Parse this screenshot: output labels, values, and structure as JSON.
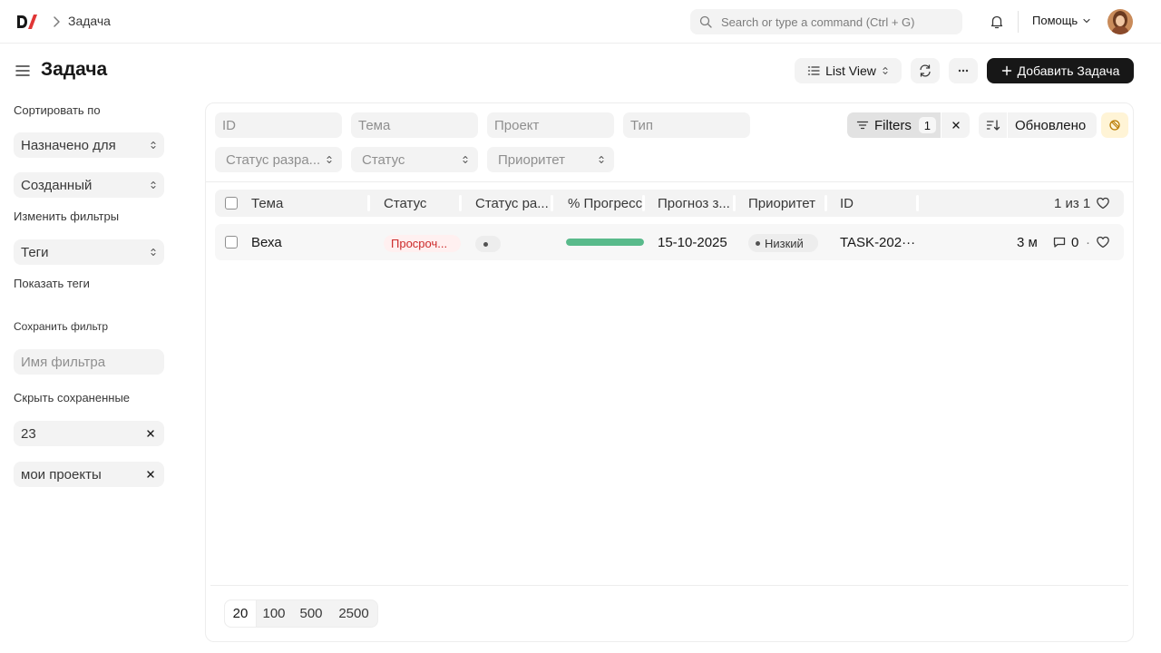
{
  "navbar": {
    "breadcrumb": "Задача",
    "search_placeholder": "Search or type a command (Ctrl + G)",
    "help_label": "Помощь"
  },
  "header": {
    "title": "Задача",
    "view_label": "List View",
    "add_label": "Добавить Задача"
  },
  "sidebar": {
    "sort_label": "Сортировать по",
    "assigned_label": "Назначено для",
    "created_label": "Созданный",
    "edit_filters_label": "Изменить фильтры",
    "tags_label": "Теги",
    "show_tags_label": "Показать теги",
    "save_filter_label": "Сохранить фильтр",
    "filter_name_placeholder": "Имя фильтра",
    "hide_saved_label": "Скрыть сохраненные",
    "saved_filters": [
      "23",
      "мои проекты"
    ]
  },
  "filters": {
    "id_placeholder": "ID",
    "subject_placeholder": "Тема",
    "project_placeholder": "Проект",
    "type_placeholder": "Тип",
    "dev_status_placeholder": "Статус разра...",
    "status_placeholder": "Статус",
    "priority_placeholder": "Приоритет",
    "filters_label": "Filters",
    "filters_count": "1",
    "sort_label": "Обновлено"
  },
  "table": {
    "columns": [
      "Тема",
      "Статус",
      "Статус ра...",
      "% Прогресс",
      "Прогноз з...",
      "Приоритет",
      "ID"
    ],
    "count_label": "1 из 1",
    "rows": [
      {
        "subject": "Веха",
        "status": "Просроч...",
        "progress": 1.0,
        "expected_end": "15-10-2025",
        "priority": "Низкий",
        "id": "TASK-202···",
        "modified": "3 м",
        "comments": "0",
        "separator": "·"
      }
    ]
  },
  "paging": {
    "sizes": [
      "20",
      "100",
      "500",
      "2500"
    ]
  },
  "colors": {
    "accent_dark": "#171717",
    "overdue_red": "#cc2929",
    "progress_green": "#59ba8b",
    "warning_bg": "#fff4d6",
    "logo_red": "#e03636"
  }
}
